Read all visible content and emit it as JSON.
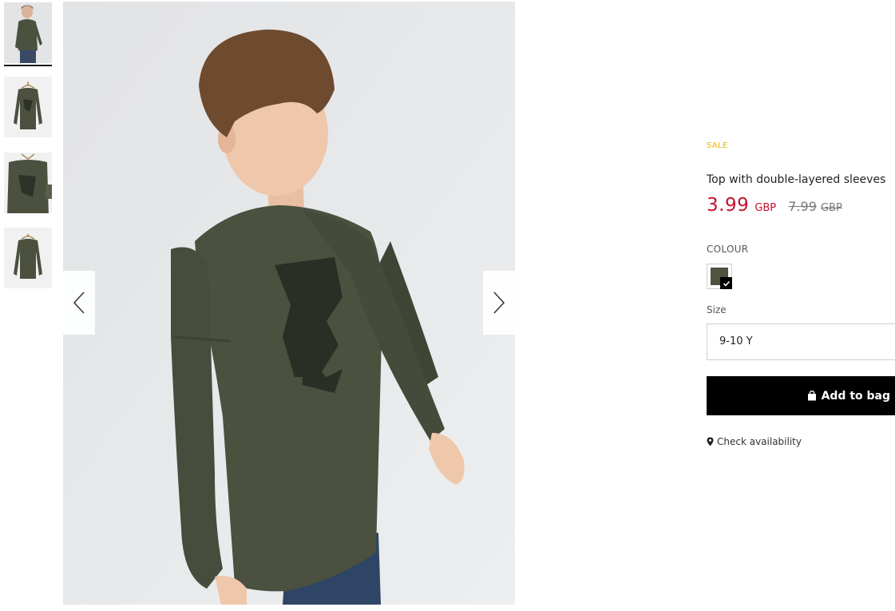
{
  "gallery": {
    "thumbnails": [
      {
        "label": "model-front",
        "active": true
      },
      {
        "label": "hanger-front",
        "active": false
      },
      {
        "label": "hanger-detail",
        "active": false
      },
      {
        "label": "hanger-back",
        "active": false
      }
    ],
    "nav": {
      "prev_icon": "chevron-left-icon",
      "next_icon": "chevron-right-icon"
    }
  },
  "product": {
    "badge": "SALE",
    "title": "Top with double-layered sleeves",
    "price": {
      "current": "3.99",
      "current_currency": "GBP",
      "original": "7.99",
      "original_currency": "GBP"
    },
    "colour": {
      "label": "COLOUR",
      "selected_swatch": "#4f5340"
    },
    "size": {
      "label": "Size",
      "selected": "9-10 Y"
    },
    "add_to_bag_label": "Add to bag",
    "check_availability_label": "Check availability"
  },
  "colors": {
    "sale": "#e8b400",
    "price": "#c8102e",
    "button": "#000000",
    "shirt": "#4b503f"
  }
}
